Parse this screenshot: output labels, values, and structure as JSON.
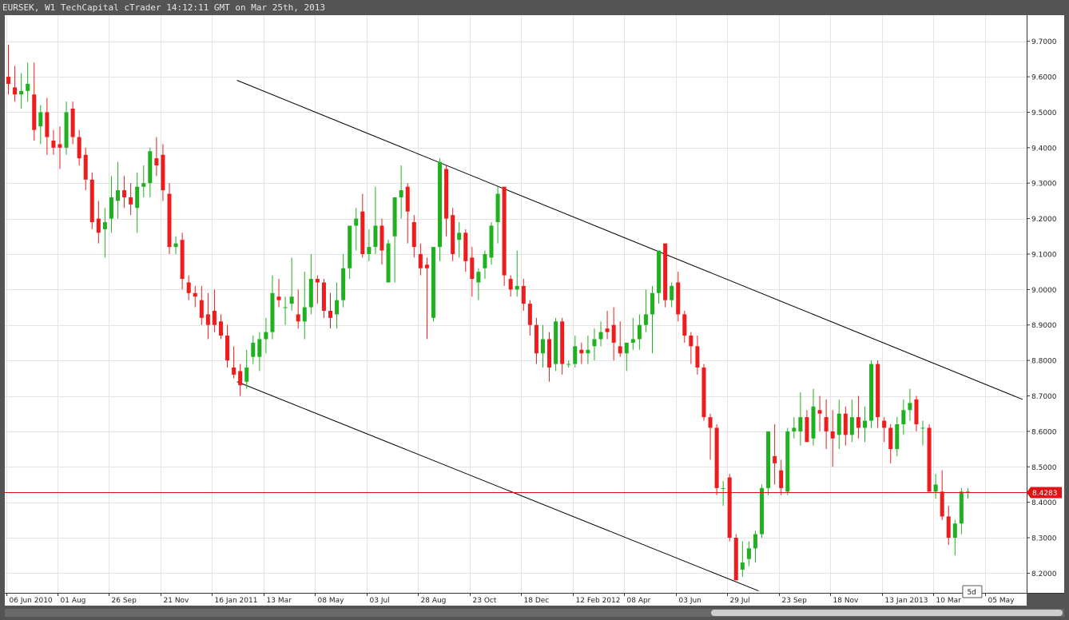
{
  "window": {
    "title": "EURSEK, W1 TechCapital cTrader 14:12:11 GMT on Mar 25th, 2013"
  },
  "colors": {
    "bull": "#1fb11f",
    "bear": "#ee1c1c",
    "price_line": "#dd1111",
    "trendline": "#000000",
    "grid": "#e4e4e4"
  },
  "chart_data": {
    "type": "candlestick",
    "symbol": "EURSEK",
    "timeframe": "W1",
    "ylim": [
      8.14,
      9.78
    ],
    "y_ticks": [
      "9.7000",
      "9.6000",
      "9.5000",
      "9.4000",
      "9.3000",
      "9.2000",
      "9.1000",
      "9.0000",
      "8.9000",
      "8.8000",
      "8.7000",
      "8.6000",
      "8.5000",
      "8.4000",
      "8.3000",
      "8.2000"
    ],
    "x_ticks": [
      {
        "label": "06 Jun 2010",
        "index": 0
      },
      {
        "label": "01 Aug",
        "index": 8
      },
      {
        "label": "26 Sep",
        "index": 16
      },
      {
        "label": "21 Nov",
        "index": 24
      },
      {
        "label": "16 Jan 2011",
        "index": 32
      },
      {
        "label": "13 Mar",
        "index": 40
      },
      {
        "label": "08 May",
        "index": 48
      },
      {
        "label": "03 Jul",
        "index": 56
      },
      {
        "label": "28 Aug",
        "index": 64
      },
      {
        "label": "23 Oct",
        "index": 72
      },
      {
        "label": "18 Dec",
        "index": 80
      },
      {
        "label": "12 Feb 2012",
        "index": 88
      },
      {
        "label": "08 Apr",
        "index": 96
      },
      {
        "label": "03 Jun",
        "index": 104
      },
      {
        "label": "29 Jul",
        "index": 112
      },
      {
        "label": "23 Sep",
        "index": 120
      },
      {
        "label": "18 Nov",
        "index": 128
      },
      {
        "label": "13 Jan 2013",
        "index": 136
      },
      {
        "label": "10 Mar",
        "index": 144
      },
      {
        "label": "05 May",
        "index": 152
      }
    ],
    "current_price": "8.4283",
    "current_price_value": 8.4283,
    "period_tag": "5d",
    "trendlines": [
      {
        "from": {
          "index": 35.5,
          "price": 9.59
        },
        "to": {
          "index": 157.5,
          "price": 8.69
        }
      },
      {
        "from": {
          "index": 35.5,
          "price": 8.74
        },
        "to": {
          "index": 116.5,
          "price": 8.15
        }
      }
    ],
    "ohlc": [
      [
        9.6,
        9.69,
        9.55,
        9.58
      ],
      [
        9.57,
        9.63,
        9.53,
        9.55
      ],
      [
        9.55,
        9.61,
        9.51,
        9.56
      ],
      [
        9.56,
        9.64,
        9.53,
        9.58
      ],
      [
        9.55,
        9.64,
        9.42,
        9.45
      ],
      [
        9.46,
        9.52,
        9.41,
        9.5
      ],
      [
        9.5,
        9.54,
        9.38,
        9.43
      ],
      [
        9.42,
        9.45,
        9.38,
        9.4
      ],
      [
        9.41,
        9.46,
        9.34,
        9.4
      ],
      [
        9.4,
        9.53,
        9.38,
        9.5
      ],
      [
        9.51,
        9.53,
        9.41,
        9.43
      ],
      [
        9.43,
        9.45,
        9.35,
        9.37
      ],
      [
        9.38,
        9.4,
        9.28,
        9.31
      ],
      [
        9.31,
        9.33,
        9.17,
        9.19
      ],
      [
        9.2,
        9.25,
        9.13,
        9.16
      ],
      [
        9.17,
        9.23,
        9.09,
        9.19
      ],
      [
        9.2,
        9.32,
        9.16,
        9.26
      ],
      [
        9.25,
        9.36,
        9.2,
        9.28
      ],
      [
        9.28,
        9.32,
        9.23,
        9.26
      ],
      [
        9.26,
        9.3,
        9.21,
        9.24
      ],
      [
        9.23,
        9.33,
        9.16,
        9.29
      ],
      [
        9.29,
        9.35,
        9.26,
        9.3
      ],
      [
        9.3,
        9.4,
        9.26,
        9.39
      ],
      [
        9.37,
        9.43,
        9.32,
        9.35
      ],
      [
        9.38,
        9.41,
        9.25,
        9.28
      ],
      [
        9.27,
        9.3,
        9.1,
        9.12
      ],
      [
        9.12,
        9.15,
        9.1,
        9.13
      ],
      [
        9.14,
        9.16,
        9.0,
        9.03
      ],
      [
        9.02,
        9.04,
        8.97,
        8.99
      ],
      [
        8.99,
        9.01,
        8.95,
        8.98
      ],
      [
        8.97,
        9.01,
        8.9,
        8.92
      ],
      [
        8.93,
        8.99,
        8.86,
        8.9
      ],
      [
        8.94,
        9.0,
        8.88,
        8.9
      ],
      [
        8.91,
        8.93,
        8.86,
        8.87
      ],
      [
        8.87,
        8.9,
        8.78,
        8.8
      ],
      [
        8.78,
        8.84,
        8.75,
        8.76
      ],
      [
        8.77,
        8.79,
        8.7,
        8.73
      ],
      [
        8.74,
        8.83,
        8.72,
        8.78
      ],
      [
        8.81,
        8.87,
        8.79,
        8.85
      ],
      [
        8.81,
        8.88,
        8.77,
        8.86
      ],
      [
        8.86,
        8.92,
        8.82,
        8.88
      ],
      [
        8.88,
        9.04,
        8.86,
        8.99
      ],
      [
        8.98,
        9.03,
        8.95,
        8.97
      ],
      [
        8.95,
        8.98,
        8.9,
        8.95
      ],
      [
        8.96,
        9.09,
        8.94,
        8.98
      ],
      [
        8.93,
        9.0,
        8.89,
        8.91
      ],
      [
        8.91,
        9.05,
        8.86,
        8.95
      ],
      [
        8.95,
        9.1,
        8.93,
        9.03
      ],
      [
        9.03,
        9.04,
        8.96,
        9.02
      ],
      [
        9.02,
        9.03,
        8.92,
        8.94
      ],
      [
        8.94,
        8.99,
        8.89,
        8.92
      ],
      [
        8.93,
        9.02,
        8.89,
        8.97
      ],
      [
        8.97,
        9.1,
        8.95,
        9.06
      ],
      [
        9.06,
        9.13,
        9.03,
        9.18
      ],
      [
        9.18,
        9.23,
        9.11,
        9.2
      ],
      [
        9.22,
        9.27,
        9.09,
        9.1
      ],
      [
        9.1,
        9.17,
        9.08,
        9.12
      ],
      [
        9.12,
        9.29,
        9.1,
        9.18
      ],
      [
        9.18,
        9.2,
        9.07,
        9.11
      ],
      [
        9.02,
        9.14,
        9.02,
        9.13
      ],
      [
        9.15,
        9.25,
        9.02,
        9.26
      ],
      [
        9.26,
        9.35,
        9.2,
        9.28
      ],
      [
        9.29,
        9.3,
        9.13,
        9.22
      ],
      [
        9.19,
        9.21,
        9.09,
        9.12
      ],
      [
        9.1,
        9.13,
        9.04,
        9.06
      ],
      [
        9.07,
        9.09,
        8.86,
        9.06
      ],
      [
        8.92,
        9.1,
        8.91,
        9.12
      ],
      [
        9.12,
        9.37,
        9.08,
        9.36
      ],
      [
        9.34,
        9.35,
        9.15,
        9.2
      ],
      [
        9.21,
        9.23,
        9.08,
        9.1
      ],
      [
        9.14,
        9.19,
        9.09,
        9.16
      ],
      [
        9.16,
        9.17,
        9.05,
        9.08
      ],
      [
        9.09,
        9.12,
        8.98,
        9.03
      ],
      [
        9.02,
        9.06,
        8.97,
        9.05
      ],
      [
        9.06,
        9.11,
        9.03,
        9.1
      ],
      [
        9.09,
        9.19,
        9.07,
        9.18
      ],
      [
        9.19,
        9.29,
        9.13,
        9.27
      ],
      [
        9.29,
        9.28,
        9.01,
        9.04
      ],
      [
        9.03,
        9.04,
        8.98,
        9.0
      ],
      [
        9.0,
        9.11,
        8.98,
        9.01
      ],
      [
        9.01,
        9.03,
        8.94,
        8.96
      ],
      [
        8.96,
        8.97,
        8.87,
        8.9
      ],
      [
        8.9,
        8.92,
        8.79,
        8.82
      ],
      [
        8.82,
        8.9,
        8.78,
        8.86
      ],
      [
        8.86,
        8.88,
        8.74,
        8.78
      ],
      [
        8.79,
        8.92,
        8.77,
        8.91
      ],
      [
        8.91,
        8.92,
        8.76,
        8.79
      ],
      [
        8.79,
        8.8,
        8.78,
        8.79
      ],
      [
        8.79,
        8.87,
        8.78,
        8.84
      ],
      [
        8.83,
        8.85,
        8.79,
        8.82
      ],
      [
        8.82,
        8.87,
        8.79,
        8.83
      ],
      [
        8.84,
        8.89,
        8.8,
        8.86
      ],
      [
        8.86,
        8.91,
        8.84,
        8.88
      ],
      [
        8.89,
        8.94,
        8.86,
        8.88
      ],
      [
        8.9,
        8.95,
        8.8,
        8.85
      ],
      [
        8.84,
        8.91,
        8.81,
        8.82
      ],
      [
        8.82,
        8.85,
        8.77,
        8.85
      ],
      [
        8.85,
        8.92,
        8.83,
        8.86
      ],
      [
        8.86,
        8.93,
        8.83,
        8.9
      ],
      [
        8.9,
        9.0,
        8.88,
        8.93
      ],
      [
        8.93,
        9.01,
        8.82,
        8.99
      ],
      [
        8.99,
        9.11,
        8.96,
        9.11
      ],
      [
        9.13,
        9.12,
        8.95,
        8.97
      ],
      [
        8.97,
        9.02,
        8.95,
        9.01
      ],
      [
        9.02,
        9.05,
        8.91,
        8.93
      ],
      [
        8.93,
        8.94,
        8.85,
        8.87
      ],
      [
        8.87,
        8.88,
        8.79,
        8.84
      ],
      [
        8.84,
        8.87,
        8.76,
        8.78
      ],
      [
        8.78,
        8.79,
        8.63,
        8.64
      ],
      [
        8.64,
        8.65,
        8.52,
        8.61
      ],
      [
        8.61,
        8.62,
        8.42,
        8.44
      ],
      [
        8.44,
        8.46,
        8.39,
        8.44
      ],
      [
        8.47,
        8.48,
        8.29,
        8.3
      ],
      [
        8.3,
        8.31,
        8.18,
        8.18
      ],
      [
        8.21,
        8.29,
        8.19,
        8.23
      ],
      [
        8.24,
        8.29,
        8.22,
        8.27
      ],
      [
        8.27,
        8.32,
        8.23,
        8.31
      ],
      [
        8.31,
        8.45,
        8.3,
        8.44
      ],
      [
        8.44,
        8.57,
        8.42,
        8.6
      ],
      [
        8.53,
        8.62,
        8.45,
        8.51
      ],
      [
        8.49,
        8.52,
        8.42,
        8.44
      ],
      [
        8.43,
        8.61,
        8.42,
        8.6
      ],
      [
        8.6,
        8.64,
        8.58,
        8.61
      ],
      [
        8.6,
        8.71,
        8.56,
        8.64
      ],
      [
        8.64,
        8.66,
        8.57,
        8.57
      ],
      [
        8.58,
        8.72,
        8.56,
        8.67
      ],
      [
        8.66,
        8.7,
        8.6,
        8.65
      ],
      [
        8.64,
        8.69,
        8.55,
        8.6
      ],
      [
        8.6,
        8.66,
        8.5,
        8.58
      ],
      [
        8.59,
        8.69,
        8.55,
        8.65
      ],
      [
        8.65,
        8.67,
        8.56,
        8.59
      ],
      [
        8.59,
        8.69,
        8.57,
        8.64
      ],
      [
        8.64,
        8.7,
        8.58,
        8.61
      ],
      [
        8.61,
        8.67,
        8.57,
        8.63
      ],
      [
        8.63,
        8.8,
        8.61,
        8.79
      ],
      [
        8.79,
        8.8,
        8.61,
        8.64
      ],
      [
        8.63,
        8.64,
        8.57,
        8.61
      ],
      [
        8.61,
        8.62,
        8.51,
        8.55
      ],
      [
        8.55,
        8.64,
        8.53,
        8.62
      ],
      [
        8.62,
        8.69,
        8.59,
        8.66
      ],
      [
        8.66,
        8.72,
        8.63,
        8.68
      ],
      [
        8.69,
        8.7,
        8.6,
        8.62
      ],
      [
        8.61,
        8.63,
        8.56,
        8.61
      ],
      [
        8.61,
        8.62,
        8.43,
        8.43
      ],
      [
        8.43,
        8.48,
        8.41,
        8.45
      ],
      [
        8.43,
        8.49,
        8.35,
        8.36
      ],
      [
        8.36,
        8.39,
        8.28,
        8.3
      ],
      [
        8.3,
        8.35,
        8.25,
        8.34
      ],
      [
        8.34,
        8.44,
        8.31,
        8.43
      ],
      [
        8.43,
        8.44,
        8.41,
        8.43
      ]
    ]
  }
}
